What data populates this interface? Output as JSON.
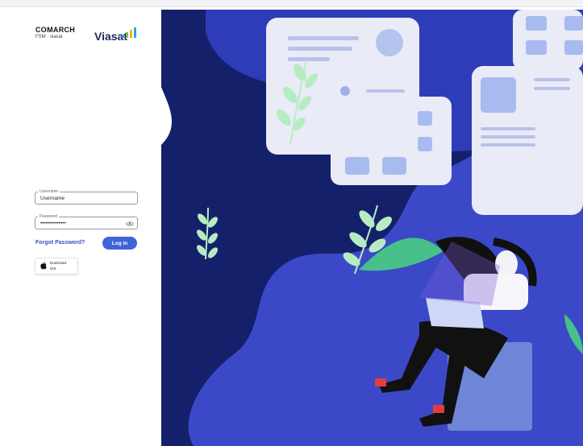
{
  "brand": {
    "name": "COMARCH",
    "subtitle": "FSM · viasat",
    "partner_logo_text": "Viasat"
  },
  "form": {
    "username_legend": "Username",
    "username_value": "Username",
    "password_legend": "Password",
    "password_value": "••••••••••••••",
    "forgot_label": "Forgot Password?",
    "login_label": "Log in"
  },
  "download": {
    "line1": "Download",
    "line2": "iOS"
  },
  "colors": {
    "navy": "#15206a",
    "blue": "#3b49c8",
    "accent_button": "#4263d8",
    "leaf": "#9fe0b7"
  }
}
